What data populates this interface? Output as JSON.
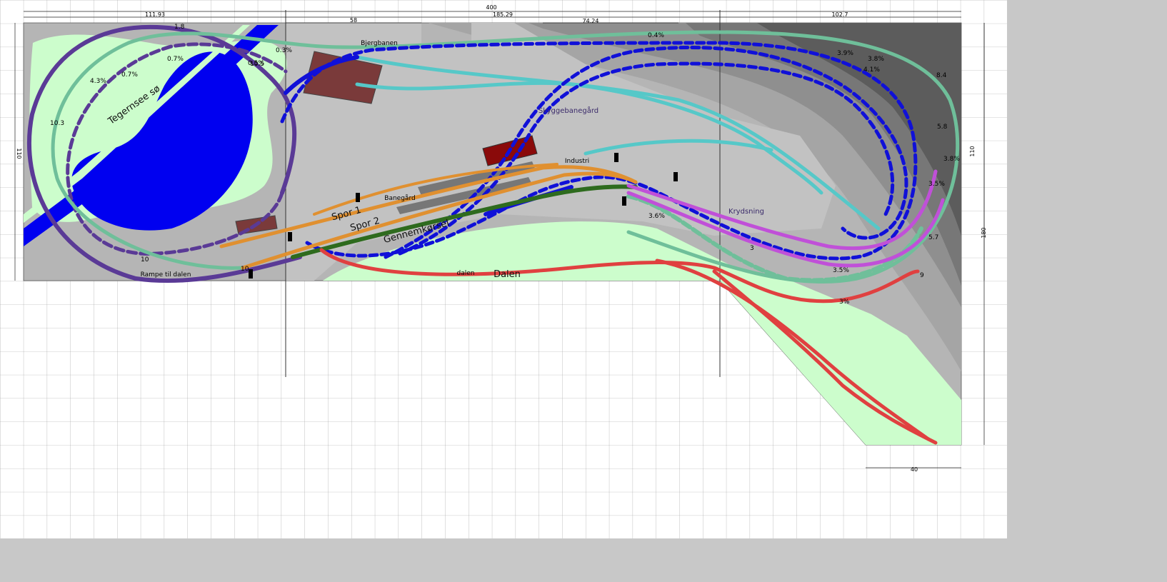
{
  "dimensions": {
    "total_width": "400",
    "left_width": "111.93",
    "mid_width": "185.29",
    "right_width": "102.7",
    "sub_a": "58",
    "sub_b": "74.24",
    "height_left": "110",
    "height_right": "110",
    "height_total": "180",
    "extension_width": "40"
  },
  "areas": {
    "lake": "Tegernsee sø",
    "valley": "Dalen",
    "valley_small": "dalen",
    "station": "Banegård",
    "station_track_1": "Spor 1",
    "station_track_2": "Spor 2",
    "through_track": "Gennemkørsel",
    "industry": "Industri",
    "crossing": "Krydsning",
    "shadow_station": "Skyggebanegård",
    "ramp": "Rampe til dalen",
    "branch": "Bjergbanen"
  },
  "grades": {
    "g1": "0.7%",
    "g2": "0.7%",
    "g3": "4.3%",
    "g4": "0.3%",
    "g5": "0.5%",
    "g6": "0.4%",
    "g7": "3.9%",
    "g8": "3.8%",
    "g9": "4.1%",
    "g10": "3.6%",
    "g11": "3.5%",
    "g12": "3%",
    "g13": "3.5%",
    "g14": "3.8%"
  },
  "elevations": {
    "e1": "10.3",
    "e2": "10",
    "e3": "10",
    "e4": "1.8",
    "e5": "10.5",
    "e6": "5.8",
    "e7": "8.4",
    "e8": "5.7",
    "e9": "3",
    "e10": "9"
  },
  "track_colors": {
    "upper_loop": "#5a3a96",
    "scenic_outer": "#6fbf9a",
    "hidden_helix": "#1010d8",
    "turquoise_branch": "#56c8c8",
    "station": "#e09030",
    "through": "#2e6b1e",
    "mainline_valley": "#e04040",
    "crossing": "#c050d8"
  }
}
